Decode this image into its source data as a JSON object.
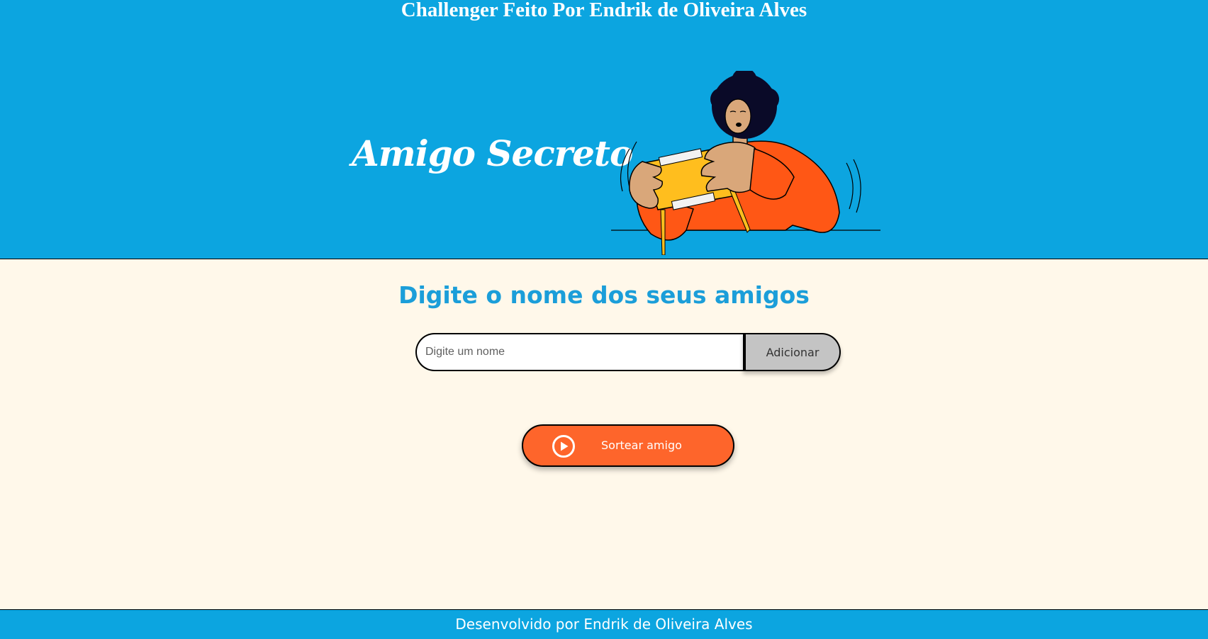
{
  "header": {
    "top_title": "Challenger Feito Por Endrik de Oliveira Alves",
    "app_title": "Amigo Secreto",
    "illustration_icon": "person-opening-gift-illustration"
  },
  "main": {
    "section_title": "Digite o nome dos seus amigos",
    "name_input": {
      "placeholder": "Digite um nome",
      "value": ""
    },
    "add_button_label": "Adicionar",
    "draw_button": {
      "label": "Sortear amigo",
      "icon": "play-circle-icon"
    }
  },
  "footer": {
    "text": "Desenvolvido por Endrik de Oliveira Alves"
  },
  "colors": {
    "header_bg": "#0CA5E0",
    "page_bg": "#FFF8EA",
    "title_blue": "#1B9ED9",
    "accent_orange": "#FE652B",
    "button_gray": "#C4C4C4"
  }
}
